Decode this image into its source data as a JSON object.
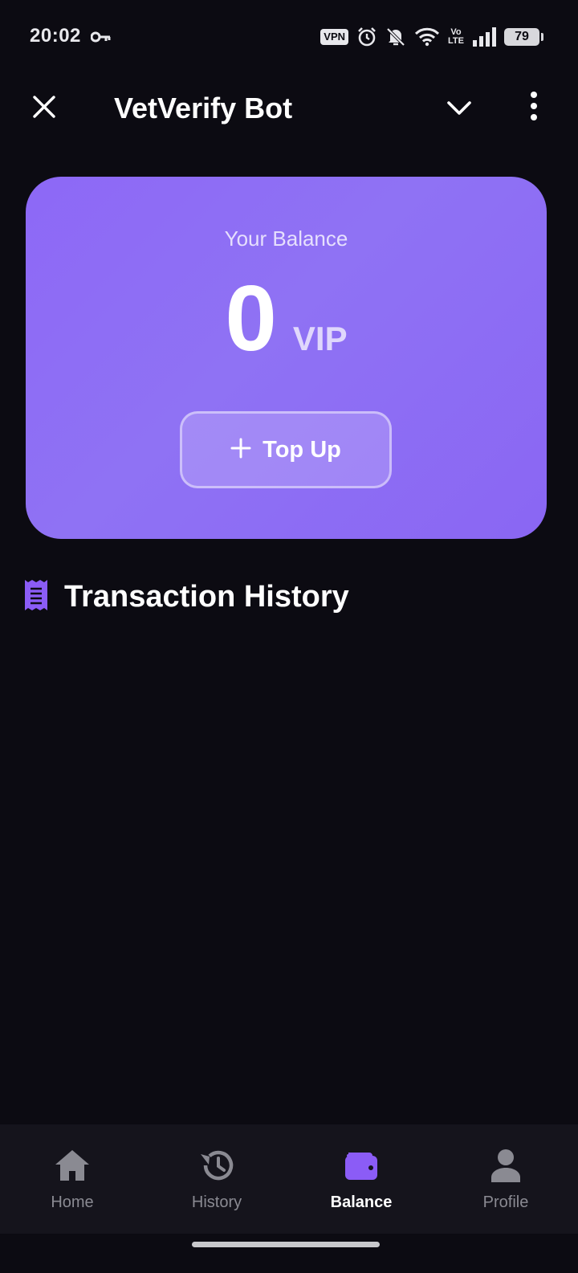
{
  "status_bar": {
    "time": "20:02",
    "vpn": "VPN",
    "volte_top": "Vo",
    "volte_bottom": "LTE",
    "battery": "79",
    "icons": [
      "key-icon",
      "alarm-icon",
      "bell-off-icon",
      "wifi-icon",
      "signal-icon",
      "battery-icon"
    ]
  },
  "header": {
    "title": "VetVerify Bot",
    "close_icon": "close-icon",
    "collapse_icon": "chevron-down-icon",
    "more_icon": "more-vertical-icon"
  },
  "balance": {
    "label": "Your Balance",
    "value": "0",
    "unit": "VIP",
    "topup_plus": "+",
    "topup_label": "Top Up"
  },
  "transactions": {
    "title": "Transaction History",
    "icon": "receipt-icon",
    "items": []
  },
  "nav": {
    "items": [
      {
        "label": "Home",
        "icon": "home-icon",
        "active": false
      },
      {
        "label": "History",
        "icon": "history-icon",
        "active": false
      },
      {
        "label": "Balance",
        "icon": "wallet-icon",
        "active": true
      },
      {
        "label": "Profile",
        "icon": "user-icon",
        "active": false
      }
    ]
  },
  "colors": {
    "background": "#0c0b12",
    "card": "#8d68f6",
    "accent": "#8b5cf6",
    "nav_background": "#15141c",
    "inactive": "#8a8a92"
  }
}
